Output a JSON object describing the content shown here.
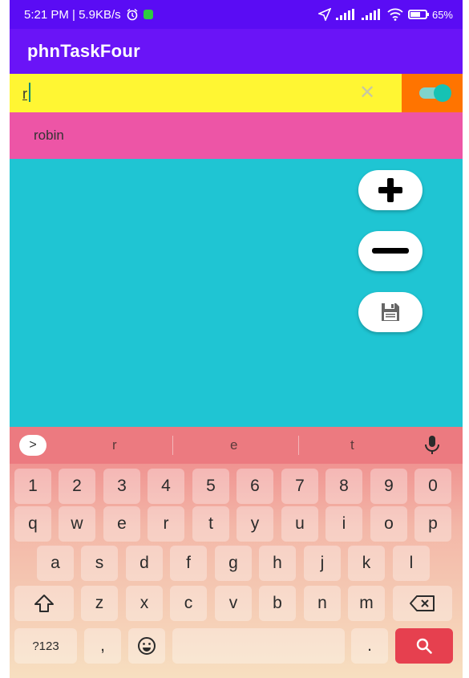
{
  "status_bar": {
    "time_speed": "5:21 PM | 5.9KB/s",
    "battery_percent": "65%",
    "battery_level": 0.65
  },
  "app": {
    "title": "phnTaskFour"
  },
  "search": {
    "value": "r",
    "clear_icon": "close-icon"
  },
  "toggle": {
    "state": "on"
  },
  "results": [
    {
      "label": "robin"
    }
  ],
  "fabs": {
    "add_icon": "plus-icon",
    "remove_icon": "minus-icon",
    "save_icon": "floppy-disk-icon"
  },
  "keyboard": {
    "suggestions": [
      "r",
      "e",
      "t"
    ],
    "row_numbers": [
      "1",
      "2",
      "3",
      "4",
      "5",
      "6",
      "7",
      "8",
      "9",
      "0"
    ],
    "row1": [
      "q",
      "w",
      "e",
      "r",
      "t",
      "y",
      "u",
      "i",
      "o",
      "p"
    ],
    "row2": [
      "a",
      "s",
      "d",
      "f",
      "g",
      "h",
      "j",
      "k",
      "l"
    ],
    "row3": [
      "z",
      "x",
      "c",
      "v",
      "b",
      "n",
      "m"
    ],
    "symbols_key": "?123",
    "comma_key": ",",
    "period_key": "."
  },
  "colors": {
    "status_bar": "#5a0cf4",
    "app_bar": "#6a14f7",
    "search_bg": "#fff633",
    "toggle_bg": "#ff7400",
    "result_bg": "#ed55a6",
    "content_bg": "#1fc5d3",
    "search_key": "#e6404f"
  }
}
